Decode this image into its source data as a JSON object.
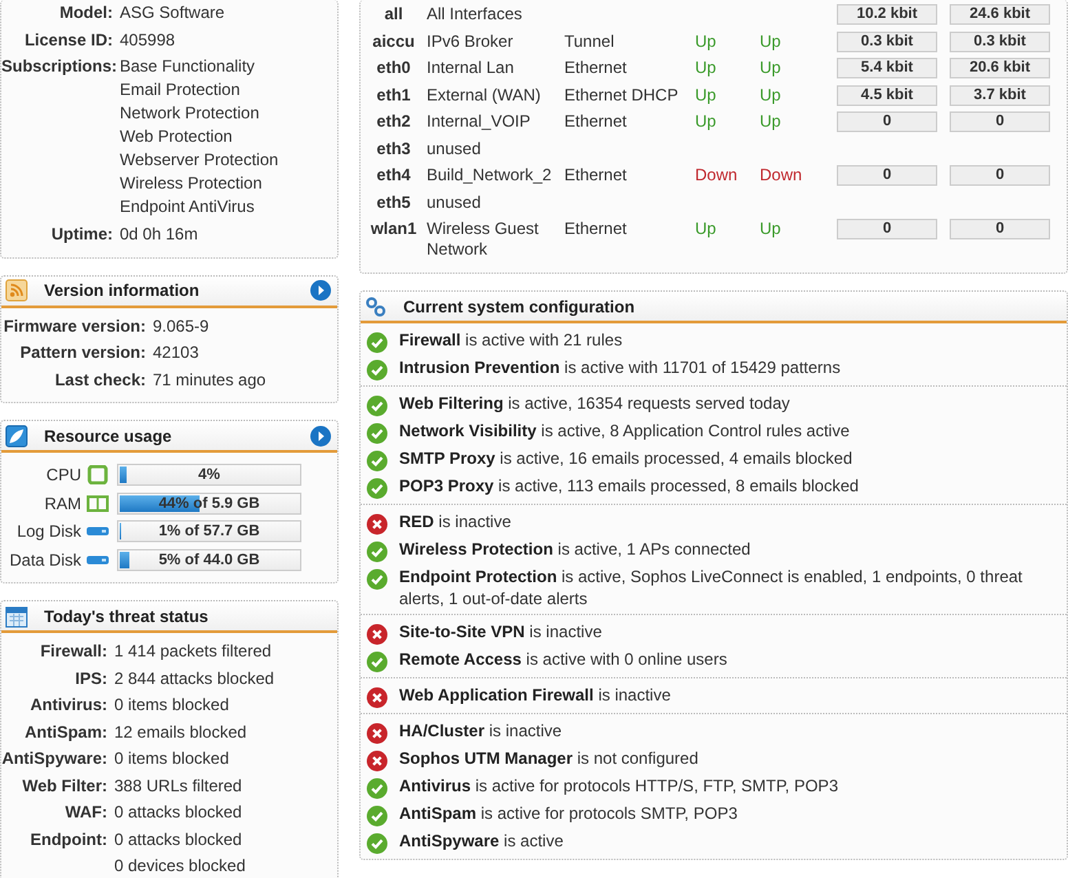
{
  "system": {
    "rows": [
      {
        "label": "Model:",
        "values": [
          "ASG Software"
        ]
      },
      {
        "label": "License ID:",
        "values": [
          "405998"
        ]
      },
      {
        "label": "Subscriptions:",
        "values": [
          "Base Functionality",
          "Email Protection",
          "Network Protection",
          "Web Protection",
          "Webserver Protection",
          "Wireless Protection",
          "Endpoint AntiVirus"
        ]
      },
      {
        "label": "Uptime:",
        "values": [
          "0d 0h 16m"
        ]
      }
    ]
  },
  "version": {
    "title": "Version information",
    "rows": [
      {
        "label": "Firmware version:",
        "value": "9.065-9"
      },
      {
        "label": "Pattern version:",
        "value": "42103"
      },
      {
        "label": "Last check:",
        "value": "71 minutes ago"
      }
    ]
  },
  "resources": {
    "title": "Resource usage",
    "items": [
      {
        "label": "CPU",
        "kind": "cpu",
        "level": 0.04,
        "reading": "4%"
      },
      {
        "label": "RAM",
        "kind": "ram",
        "level": 0.44,
        "reading": "44% of 5.9 GB"
      },
      {
        "label": "Log Disk",
        "kind": "disk",
        "level": 0.01,
        "reading": "1% of 57.7 GB"
      },
      {
        "label": "Data Disk",
        "kind": "disk",
        "level": 0.05,
        "reading": "5% of 44.0 GB"
      }
    ]
  },
  "threats": {
    "title": "Today's threat status",
    "rows": [
      {
        "label": "Firewall:",
        "values": [
          "1 414 packets filtered"
        ]
      },
      {
        "label": "IPS:",
        "values": [
          "2 844 attacks blocked"
        ]
      },
      {
        "label": "Antivirus:",
        "values": [
          "0 items blocked"
        ]
      },
      {
        "label": "AntiSpam:",
        "values": [
          "12 emails blocked"
        ]
      },
      {
        "label": "AntiSpyware:",
        "values": [
          "0 items blocked"
        ]
      },
      {
        "label": "Web Filter:",
        "values": [
          "388 URLs filtered"
        ]
      },
      {
        "label": "WAF:",
        "values": [
          "0 attacks blocked"
        ]
      },
      {
        "label": "Endpoint:",
        "values": [
          "0 attacks blocked",
          "0 devices blocked"
        ]
      }
    ]
  },
  "interfaces": [
    {
      "name": "all",
      "description": "All Interfaces",
      "in": "10.2 kbit",
      "out": "24.6 kbit"
    },
    {
      "name": "aiccu",
      "description": "IPv6 Broker",
      "type": "Tunnel",
      "link": {
        "text": "Up",
        "ok": true
      },
      "status": {
        "text": "Up",
        "ok": true
      },
      "in": "0.3 kbit",
      "out": "0.3 kbit"
    },
    {
      "name": "eth0",
      "description": "Internal Lan",
      "type": "Ethernet",
      "link": {
        "text": "Up",
        "ok": true
      },
      "status": {
        "text": "Up",
        "ok": true
      },
      "in": "5.4 kbit",
      "out": "20.6 kbit"
    },
    {
      "name": "eth1",
      "description": "External (WAN)",
      "type": "Ethernet DHCP",
      "link": {
        "text": "Up",
        "ok": true
      },
      "status": {
        "text": "Up",
        "ok": true
      },
      "in": "4.5 kbit",
      "out": "3.7 kbit"
    },
    {
      "name": "eth2",
      "description": "Internal_VOIP",
      "type": "Ethernet",
      "link": {
        "text": "Up",
        "ok": true
      },
      "status": {
        "text": "Up",
        "ok": true
      },
      "in": "0",
      "out": "0"
    },
    {
      "name": "eth3",
      "description": "unused"
    },
    {
      "name": "eth4",
      "description": "Build_Network_2",
      "type": "Ethernet",
      "link": {
        "text": "Down",
        "ok": false
      },
      "status": {
        "text": "Down",
        "ok": false
      },
      "in": "0",
      "out": "0"
    },
    {
      "name": "eth5",
      "description": "unused"
    },
    {
      "name": "wlan1",
      "description": "Wireless Guest Network",
      "type": "Ethernet",
      "link": {
        "text": "Up",
        "ok": true
      },
      "status": {
        "text": "Up",
        "ok": true
      },
      "in": "0",
      "out": "0"
    }
  ],
  "configuration": {
    "title": "Current system configuration",
    "groups": [
      [
        {
          "text": "**Firewall** is active with 21 rules",
          "active": true
        },
        {
          "text": "**Intrusion Prevention** is active with 11701 of 15429 patterns",
          "active": true
        }
      ],
      [
        {
          "text": "**Web Filtering** is active, 16354 requests served today",
          "active": true
        },
        {
          "text": "**Network Visibility** is active, 8 Application Control rules active",
          "active": true
        },
        {
          "text": "**SMTP Proxy** is active, 16 emails processed, 4 emails blocked",
          "active": true
        },
        {
          "text": "**POP3 Proxy** is active, 113 emails processed, 8 emails blocked",
          "active": true
        }
      ],
      [
        {
          "text": "**RED** is inactive",
          "active": false
        },
        {
          "text": "**Wireless Protection** is active, 1 APs connected",
          "active": true
        },
        {
          "text": "**Endpoint Protection** is active, Sophos LiveConnect is enabled, 1 endpoints, 0 threat alerts, 1 out-of-date alerts",
          "active": true
        }
      ],
      [
        {
          "text": "**Site-to-Site VPN** is inactive",
          "active": false
        },
        {
          "text": "**Remote Access** is active with 0 online users",
          "active": true
        }
      ],
      [
        {
          "text": "**Web Application Firewall** is inactive",
          "active": false
        }
      ],
      [
        {
          "text": "**HA/Cluster** is inactive",
          "active": false
        },
        {
          "text": "**Sophos UTM Manager** is not configured",
          "active": false
        },
        {
          "text": "**Antivirus** is active for protocols HTTP/S, FTP, SMTP, POP3",
          "active": true
        },
        {
          "text": "**AntiSpam** is active for protocols SMTP, POP3",
          "active": true
        },
        {
          "text": "**AntiSpyware** is active",
          "active": true
        }
      ]
    ]
  }
}
